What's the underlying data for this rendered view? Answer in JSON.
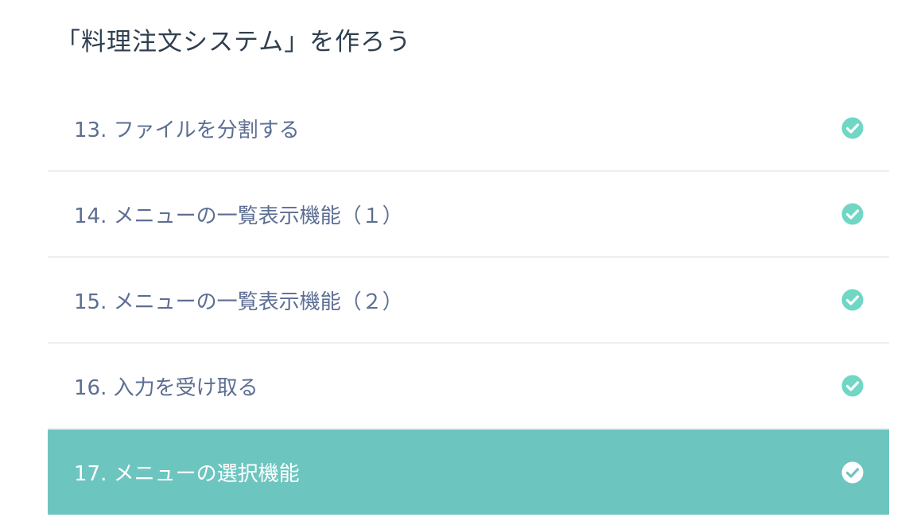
{
  "section": {
    "title": "「料理注文システム」を作ろう"
  },
  "lessons": [
    {
      "label": "13. ファイルを分割する",
      "completed": true,
      "active": false
    },
    {
      "label": "14. メニューの一覧表示機能（１）",
      "completed": true,
      "active": false
    },
    {
      "label": "15. メニューの一覧表示機能（２）",
      "completed": true,
      "active": false
    },
    {
      "label": "16. 入力を受け取る",
      "completed": true,
      "active": false
    },
    {
      "label": "17. メニューの選択機能",
      "completed": true,
      "active": true
    }
  ],
  "colors": {
    "check": "#6fd7c4",
    "active_bg": "#6dc5c0",
    "label": "#5d6e93",
    "title": "#2f3f4f"
  }
}
